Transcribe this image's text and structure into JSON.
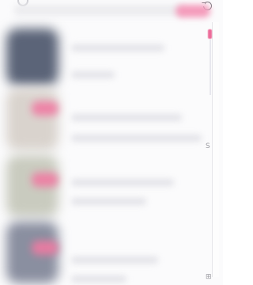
{
  "colors": {
    "accent": "#ec6d9a",
    "background": "#fbfbfc",
    "placeholder": "#e3e3e8"
  },
  "topbar": {
    "left_icon": "circle-icon",
    "right_icon": "refresh-icon"
  },
  "sidebar_glyphs": {
    "middle": "S",
    "bottom": "⊞"
  },
  "list": {
    "items": [
      {
        "thumb_color": "#5b6478",
        "badge": false
      },
      {
        "thumb_color": "#d9d3cd",
        "badge": true
      },
      {
        "thumb_color": "#c9cbbf",
        "badge": true
      },
      {
        "thumb_color": "#c6c6c6",
        "badge": true
      }
    ]
  }
}
